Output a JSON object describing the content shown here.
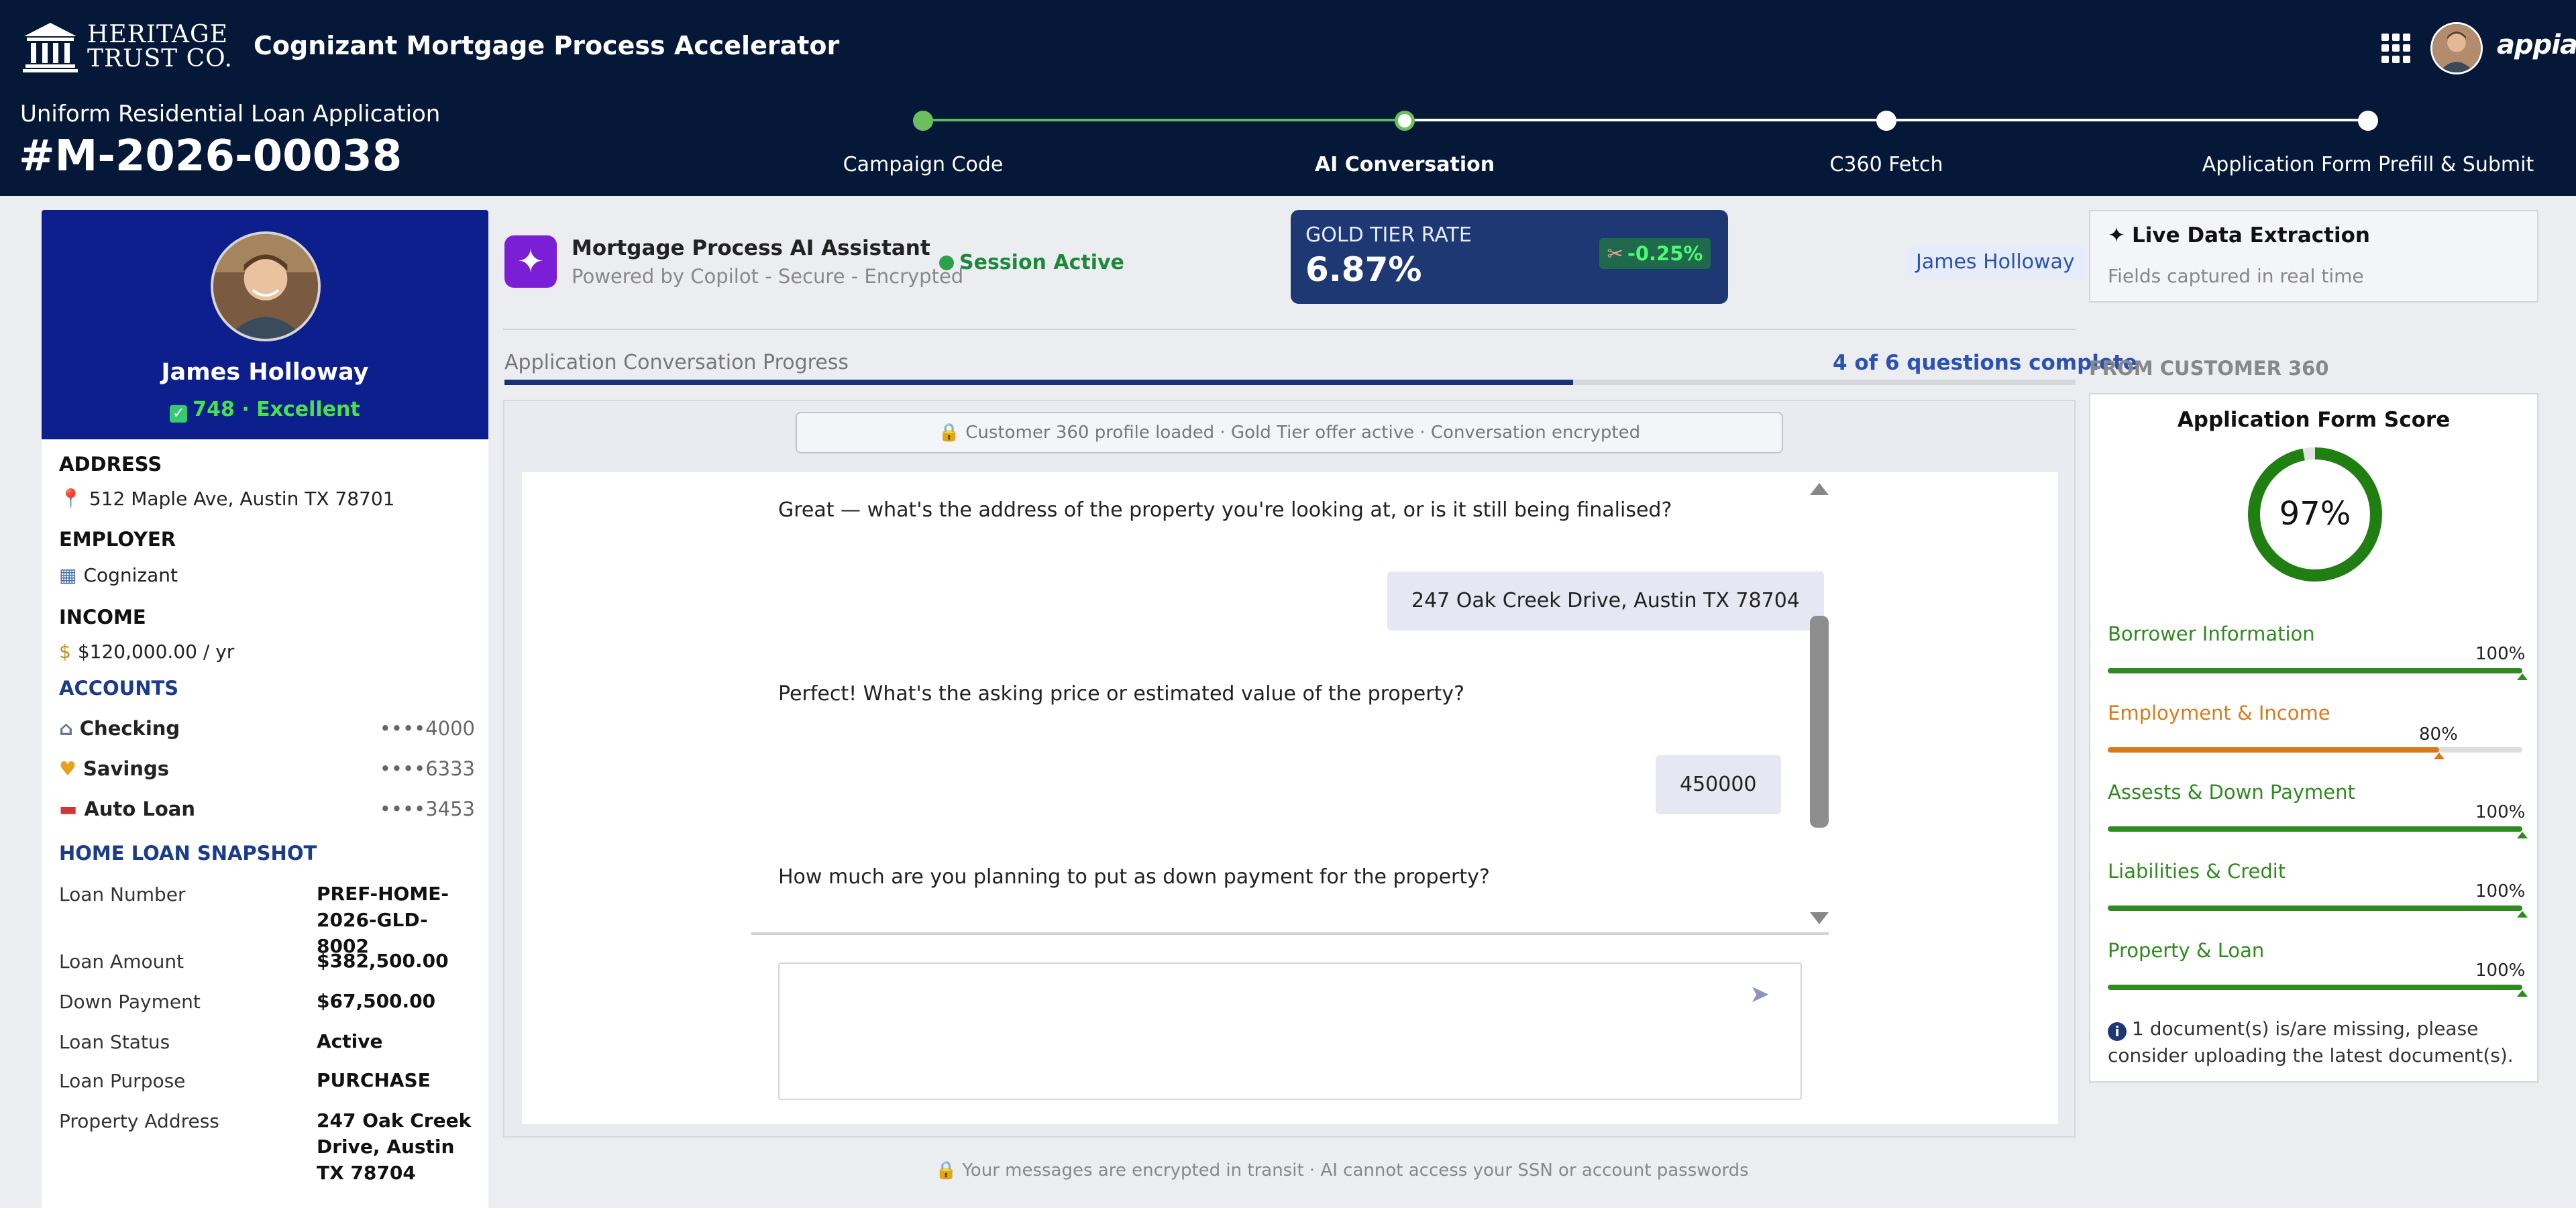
{
  "header": {
    "brand_line1": "HERITAGE",
    "brand_line2": "TRUST CO.",
    "app_title": "Cognizant Mortgage Process Accelerator",
    "appian_logo": "appian",
    "subtitle": "Uniform Residential Loan Application",
    "application_id": "#M-2026-00038"
  },
  "stepper": {
    "steps": [
      {
        "label": "Campaign Code",
        "state": "done"
      },
      {
        "label": "AI Conversation",
        "state": "current"
      },
      {
        "label": "C360 Fetch",
        "state": "pending"
      },
      {
        "label": "Application Form Prefill & Submit",
        "state": "pending"
      }
    ],
    "done_color": "#6bbf5c"
  },
  "profile": {
    "name": "James Holloway",
    "credit_score": "748 · Excellent",
    "address_label": "ADDRESS",
    "address": "512 Maple Ave, Austin TX 78701",
    "employer_label": "EMPLOYER",
    "employer": "Cognizant",
    "income_label": "INCOME",
    "income": "$120,000.00 / yr",
    "accounts_label": "ACCOUNTS",
    "accounts": [
      {
        "name": "Checking",
        "mask": "••••4000",
        "icon": "bank-icon"
      },
      {
        "name": "Savings",
        "mask": "••••6333",
        "icon": "heart-icon"
      },
      {
        "name": "Auto Loan",
        "mask": "••••3453",
        "icon": "car-icon"
      }
    ],
    "snapshot_label": "HOME LOAN SNAPSHOT",
    "snapshot": [
      {
        "key": "Loan Number",
        "value": "PREF-HOME-2026-GLD-8002"
      },
      {
        "key": "Loan Amount",
        "value": "$382,500.00"
      },
      {
        "key": "Down Payment",
        "value": "$67,500.00"
      },
      {
        "key": "Loan Status",
        "value": "Active"
      },
      {
        "key": "Loan Purpose",
        "value": "PURCHASE"
      },
      {
        "key": "Property Address",
        "value": "247 Oak Creek Drive, Austin TX 78704"
      }
    ]
  },
  "assistant": {
    "title": "Mortgage Process AI Assistant",
    "subtitle": "Powered by Copilot - Secure - Encrypted",
    "session_status": "Session Active",
    "user_pill": "James Holloway"
  },
  "rate_card": {
    "label": "GOLD TIER RATE",
    "value": "6.87%",
    "delta": "-0.25%"
  },
  "progress": {
    "label": "Application Conversation Progress",
    "count_text": "4 of 6 questions complete",
    "fraction": 0.68
  },
  "chat": {
    "banner": "Customer 360 profile loaded · Gold Tier offer active · Conversation encrypted",
    "messages": [
      {
        "role": "bot",
        "text": "Great — what's the address of the property you're looking at, or is it still being finalised?"
      },
      {
        "role": "user",
        "text": "247 Oak Creek Drive, Austin TX 78704"
      },
      {
        "role": "bot",
        "text": "Perfect! What's the asking price or estimated value of the property?"
      },
      {
        "role": "user",
        "text": "450000"
      },
      {
        "role": "bot",
        "text": "How much are you planning to put as down payment for the property?"
      }
    ],
    "input_value": "",
    "footer": "Your messages are encrypted in transit · AI cannot access your SSN or account passwords"
  },
  "live_extraction": {
    "title": "Live Data Extraction",
    "subtitle": "Fields captured in real time"
  },
  "customer360": {
    "section_label": "FROM CUSTOMER 360",
    "score_title": "Application Form Score",
    "score_value": "97%",
    "score_fraction": 0.97,
    "sections": [
      {
        "name": "Borrower Information",
        "percent": "100%",
        "fraction": 1.0,
        "color": "#2f8a1f"
      },
      {
        "name": "Employment & Income",
        "percent": "80%",
        "fraction": 0.8,
        "color": "#d87a1c"
      },
      {
        "name": "Assests & Down Payment",
        "percent": "100%",
        "fraction": 1.0,
        "color": "#2f8a1f"
      },
      {
        "name": "Liabilities & Credit",
        "percent": "100%",
        "fraction": 1.0,
        "color": "#2f8a1f"
      },
      {
        "name": "Property & Loan",
        "percent": "100%",
        "fraction": 1.0,
        "color": "#2f8a1f"
      }
    ],
    "missing_note": "1 document(s) is/are missing, please consider uploading the latest document(s)."
  }
}
